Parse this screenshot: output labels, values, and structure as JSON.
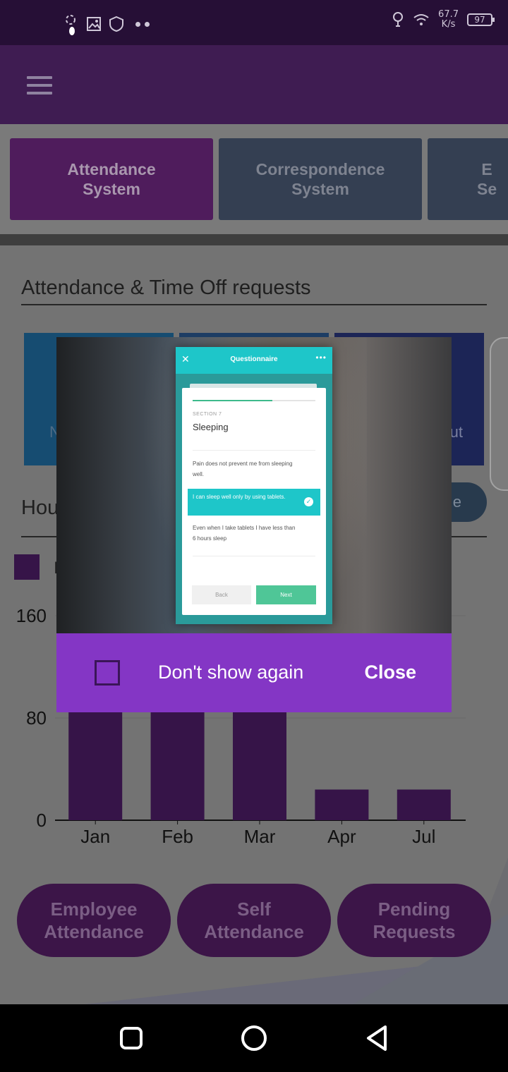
{
  "status_bar": {
    "net_speed_value": "67.7",
    "net_speed_unit": "K/s",
    "battery": "97",
    "icons": [
      "spinner-icon",
      "image-icon",
      "shield-icon",
      "more-dots-icon",
      "bulb-icon",
      "wifi-icon",
      "battery-icon"
    ]
  },
  "app_bar": {
    "menu_icon": "hamburger-icon"
  },
  "system_tabs": [
    {
      "label": "Attendance\nSystem",
      "active": true
    },
    {
      "label": "Correspondence\nSystem",
      "active": false
    },
    {
      "label": "E\nSe",
      "active": false
    }
  ],
  "section_title": "Attendance & Time Off requests",
  "tiles": [
    {
      "label": "N"
    },
    {
      "label": ""
    },
    {
      "label": "ut"
    }
  ],
  "hours": {
    "label": "Hou",
    "button_label": "e"
  },
  "legend": {
    "label": "I"
  },
  "chart_data": {
    "type": "bar",
    "categories": [
      "Jan",
      "Feb",
      "Mar",
      "Apr",
      "Jul"
    ],
    "values": [
      120,
      120,
      120,
      24,
      24
    ],
    "yticks": [
      0,
      80,
      160
    ],
    "ylim": [
      0,
      160
    ],
    "color": "#361448"
  },
  "bottom_buttons": [
    {
      "label": "Employee\nAttendance"
    },
    {
      "label": "Self\nAttendance"
    },
    {
      "label": "Pending\nRequests"
    }
  ],
  "dialog": {
    "phone": {
      "title": "Questionnaire",
      "progress": 0.65,
      "section_label": "SECTION 7",
      "section_title": "Sleeping",
      "options": [
        {
          "text": "Pain does not prevent me from sleeping well.",
          "selected": false
        },
        {
          "text": "I can sleep well only by using tablets.",
          "selected": true
        },
        {
          "text": "Even when I take tablets I have less than 6 hours sleep",
          "selected": false
        }
      ],
      "back_label": "Back",
      "next_label": "Next",
      "accent": "#1ec6c9"
    },
    "dont_show_label": "Don't show again",
    "dont_show_checked": false,
    "close_label": "Close",
    "bar_color": "#8436c5"
  },
  "nav_bar": {
    "icons": [
      "recents-square-icon",
      "home-circle-icon",
      "back-triangle-icon"
    ]
  }
}
